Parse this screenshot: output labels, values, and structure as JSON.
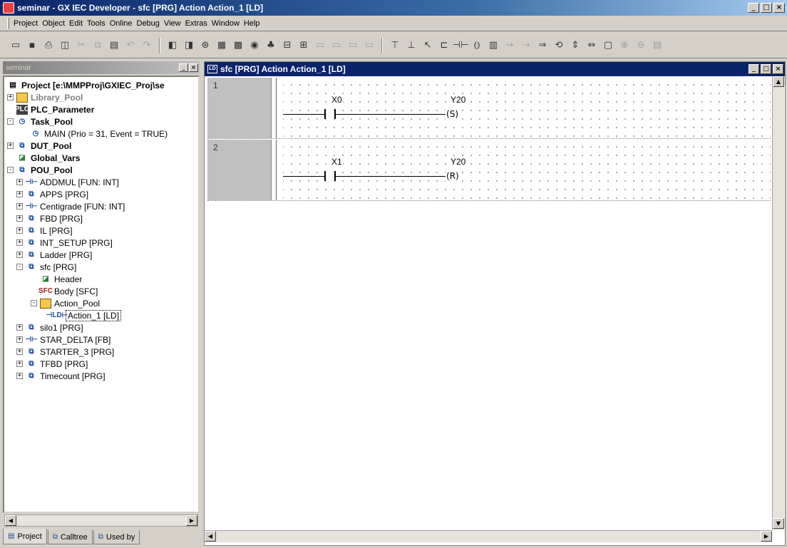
{
  "window": {
    "title": "seminar - GX IEC Developer - sfc [PRG] Action Action_1 [LD]",
    "controls": [
      "_",
      "□",
      "×"
    ]
  },
  "menu": [
    "Project",
    "Object",
    "Edit",
    "Tools",
    "Online",
    "Debug",
    "View",
    "Extras",
    "Window",
    "Help"
  ],
  "toolbar": {
    "icons": [
      "open-icon",
      "save-icon",
      "print-icon",
      "print-preview-icon",
      "cut-icon",
      "copy-icon",
      "paste-icon",
      "undo-icon",
      "redo-icon",
      "new-object-icon",
      "open-object-icon",
      "check-icon",
      "compile-icon",
      "build-icon",
      "monitor-icon",
      "transfer-icon",
      "download-icon",
      "upload-icon",
      "view1-icon",
      "view2-icon",
      "view3-icon",
      "view4-icon",
      "insert-row-above-icon",
      "insert-row-below-icon",
      "select-pointer-icon",
      "line-tool-icon",
      "contact-icon",
      "coil-icon",
      "function-block-icon",
      "var-input-icon",
      "var-output-icon",
      "jump-icon",
      "return-icon",
      "negate-icon",
      "connect-icon",
      "comment-icon",
      "zoom-in-icon",
      "zoom-out-icon",
      "extra-icon"
    ]
  },
  "left_panel": {
    "title": "seminar",
    "tree": [
      {
        "label": "Project [e:\\MMPProj\\GXIEC_Proj\\se",
        "bold": true,
        "icon": "project-icon",
        "level": 0
      },
      {
        "label": "Library_Pool",
        "bold": true,
        "grey": true,
        "icon": "library-pool-icon",
        "level": 1,
        "exp": "+"
      },
      {
        "label": "PLC_Parameter",
        "bold": true,
        "icon": "plc-parameter-icon",
        "level": 1
      },
      {
        "label": "Task_Pool",
        "bold": true,
        "icon": "task-pool-icon",
        "level": 1,
        "exp": "-"
      },
      {
        "label": "MAIN (Prio = 31, Event = TRUE)",
        "icon": "task-icon",
        "level": 2
      },
      {
        "label": "DUT_Pool",
        "bold": true,
        "icon": "dut-pool-icon",
        "level": 1,
        "exp": "+"
      },
      {
        "label": "Global_Vars",
        "bold": true,
        "icon": "global-vars-icon",
        "level": 1
      },
      {
        "label": "POU_Pool",
        "bold": true,
        "icon": "pou-pool-icon",
        "level": 1,
        "exp": "-"
      },
      {
        "label": "ADDMUL [FUN: INT]",
        "icon": "function-icon",
        "level": 2,
        "exp": "+"
      },
      {
        "label": "APPS [PRG]",
        "icon": "program-icon",
        "level": 2,
        "exp": "+"
      },
      {
        "label": "Centigrade [FUN: INT]",
        "icon": "function-icon",
        "level": 2,
        "exp": "+"
      },
      {
        "label": "FBD [PRG]",
        "icon": "program-icon",
        "level": 2,
        "exp": "+"
      },
      {
        "label": "IL [PRG]",
        "icon": "program-icon",
        "level": 2,
        "exp": "+"
      },
      {
        "label": "INT_SETUP [PRG]",
        "icon": "program-icon",
        "level": 2,
        "exp": "+"
      },
      {
        "label": "Ladder [PRG]",
        "icon": "program-icon",
        "level": 2,
        "exp": "+"
      },
      {
        "label": "sfc [PRG]",
        "icon": "program-icon",
        "level": 2,
        "exp": "-"
      },
      {
        "label": "Header",
        "icon": "header-icon",
        "level": 3
      },
      {
        "label": "Body [SFC]",
        "icon": "sfc-body-icon",
        "level": 3
      },
      {
        "label": "Action_Pool",
        "icon": "action-pool-icon",
        "level": 3,
        "exp": "-"
      },
      {
        "label": "Action_1 [LD]",
        "icon": "ld-action-icon",
        "level": 4,
        "selected": true
      },
      {
        "label": "silo1 [PRG]",
        "icon": "program-icon",
        "level": 2,
        "exp": "+"
      },
      {
        "label": "STAR_DELTA [FB]",
        "icon": "function-block-icon",
        "level": 2,
        "exp": "+"
      },
      {
        "label": "STARTER_3 [PRG]",
        "icon": "program-icon",
        "level": 2,
        "exp": "+"
      },
      {
        "label": "TFBD [PRG]",
        "icon": "program-icon",
        "level": 2,
        "exp": "+"
      },
      {
        "label": "Timecount [PRG]",
        "icon": "program-icon",
        "level": 2,
        "exp": "+"
      }
    ],
    "tabs": [
      {
        "label": "Project",
        "icon": "project-tab-icon"
      },
      {
        "label": "Calltree",
        "icon": "calltree-icon"
      },
      {
        "label": "Used by",
        "icon": "used-by-icon"
      }
    ]
  },
  "editor": {
    "title": "sfc [PRG] Action Action_1 [LD]",
    "ld_icon": "LD",
    "rungs": [
      {
        "number": "1",
        "contact": "X0",
        "coil": "Y20",
        "coil_type": "S"
      },
      {
        "number": "2",
        "contact": "X1",
        "coil": "Y20",
        "coil_type": "R"
      }
    ]
  }
}
